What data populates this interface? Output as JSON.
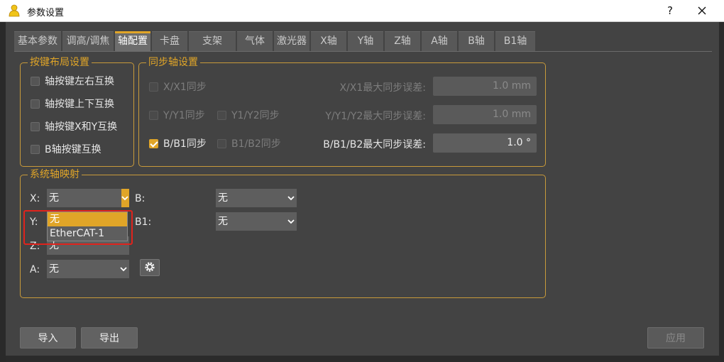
{
  "window": {
    "title": "参数设置",
    "help_label": "?",
    "icon": "user-icon",
    "close_icon": "close-icon"
  },
  "tabs": [
    {
      "label": "基本参数"
    },
    {
      "label": "调高/调焦"
    },
    {
      "label": "轴配置",
      "active": true
    },
    {
      "label": "卡盘"
    },
    {
      "label": "支架"
    },
    {
      "label": "气体"
    },
    {
      "label": "激光器"
    },
    {
      "label": "X轴"
    },
    {
      "label": "Y轴"
    },
    {
      "label": "Z轴"
    },
    {
      "label": "A轴"
    },
    {
      "label": "B轴"
    },
    {
      "label": "B1轴"
    }
  ],
  "button_layout": {
    "title": "按键布局设置",
    "options": [
      {
        "label": "轴按键左右互换",
        "checked": false
      },
      {
        "label": "轴按键上下互换",
        "checked": false
      },
      {
        "label": "轴按键X和Y互换",
        "checked": false
      },
      {
        "label": "B轴按键互换",
        "checked": false
      }
    ]
  },
  "sync_axis": {
    "title": "同步轴设置",
    "rows": [
      {
        "sync1": "X/X1同步",
        "sync1_checked": false,
        "sync1_enabled": false,
        "error_label": "X/X1最大同步误差:",
        "error_value": "1.0 mm",
        "error_enabled": false
      },
      {
        "sync1": "Y/Y1同步",
        "sync1_checked": false,
        "sync1_enabled": false,
        "sync2": "Y1/Y2同步",
        "sync2_checked": false,
        "sync2_enabled": false,
        "error_label": "Y/Y1/Y2最大同步误差:",
        "error_value": "1.0 mm",
        "error_enabled": false
      },
      {
        "sync1": "B/B1同步",
        "sync1_checked": true,
        "sync1_enabled": true,
        "sync2": "B1/B2同步",
        "sync2_checked": false,
        "sync2_enabled": false,
        "error_label": "B/B1/B2最大同步误差:",
        "error_value": "1.0 °",
        "error_enabled": true
      }
    ]
  },
  "axis_mapping": {
    "title": "系统轴映射",
    "axes": [
      {
        "label": "X:",
        "value": "无"
      },
      {
        "label": "Y:",
        "value": "无"
      },
      {
        "label": "Z:",
        "value": "无"
      },
      {
        "label": "A:",
        "value": "无"
      },
      {
        "label": "B:",
        "value": "无"
      },
      {
        "label": "B1:",
        "value": "无"
      }
    ],
    "open_dropdown": {
      "options": [
        "无",
        "EtherCAT-1"
      ],
      "selected_index": 0
    },
    "gear_icon": "gear-icon",
    "highlight_color": "#e0231c"
  },
  "footer": {
    "import_label": "导入",
    "export_label": "导出",
    "apply_label": "应用"
  },
  "colors": {
    "accent": "#e0a528",
    "background": "#434343",
    "field": "#5e5e5e"
  }
}
